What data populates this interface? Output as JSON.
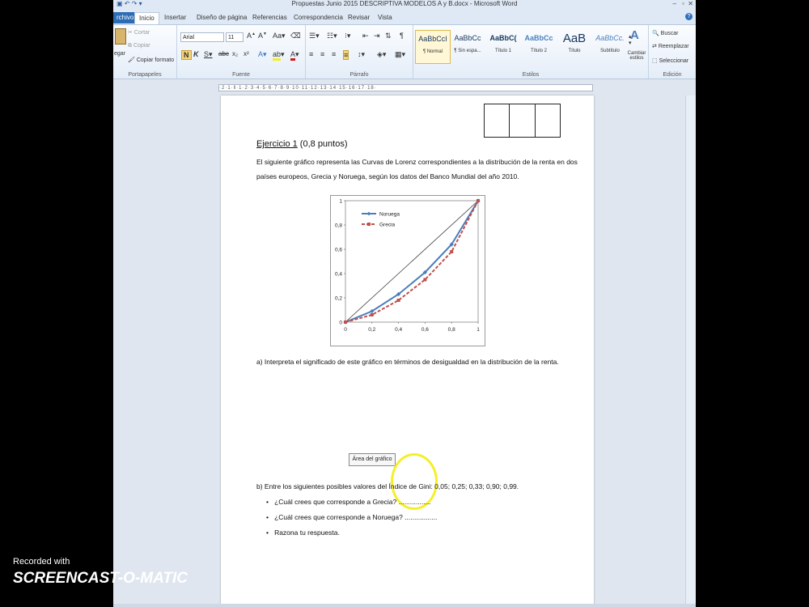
{
  "window": {
    "title": "Propuestas Junio 2015 DESCRIPTIVA MODELOS A y B.docx - Microsoft Word"
  },
  "tabs": [
    "rchivo",
    "Inicio",
    "Insertar",
    "Diseño de página",
    "Referencias",
    "Correspondencia",
    "Revisar",
    "Vista"
  ],
  "ribbon": {
    "clipboard": {
      "paste_label": "egar",
      "cut": "Cortar",
      "copy": "Copiar",
      "format_painter": "Copiar formato",
      "group": "Portapapeles"
    },
    "font": {
      "name": "Arial",
      "size": "11",
      "group": "Fuente"
    },
    "paragraph": {
      "group": "Párrafo"
    },
    "styles": {
      "items": [
        {
          "preview": "AaBbCcI",
          "label": "¶ Normal"
        },
        {
          "preview": "AaBbCc",
          "label": "¶ Sin espa..."
        },
        {
          "preview": "AaBbC(",
          "label": "Título 1"
        },
        {
          "preview": "AaBbCc",
          "label": "Título 2"
        },
        {
          "preview": "AaB",
          "label": "Título"
        },
        {
          "preview": "AaBbCc.",
          "label": "Subtítulo"
        }
      ],
      "change_label": "Cambiar estilos",
      "group": "Estilos"
    },
    "editing": {
      "find": "Buscar",
      "replace": "Reemplazar",
      "select": "Seleccionar",
      "group": "Edición"
    }
  },
  "doc": {
    "heading_underlined": "Ejercicio 1",
    "heading_rest": " (0,8 puntos)",
    "para_line1": "El siguiente gráfico representa las Curvas de Lorenz correspondientes a la distribución de la renta en dos",
    "para_line2": "países europeos, Grecia y Noruega, según los datos del Banco Mundial del año 2010.",
    "question_a": "a)  Interpreta el significado de este gráfico en términos de desigualdad en la distribución de la renta.",
    "chart_tooltip": "Área del gráfico",
    "question_b": "b)  Entre los siguientes posibles valores del Índice de Gini: 0,05; 0,25; 0,33; 0,90; 0,99.",
    "bullet1": "¿Cuál crees que corresponde a Grecia? .................",
    "bullet2": "¿Cuál crees que corresponde a Noruega? .................",
    "bullet3": "Razona tu respuesta."
  },
  "watermark": {
    "recorded": "Recorded with",
    "brand": "SCREENCAST-O-MATIC"
  },
  "chart_data": {
    "type": "line",
    "x": [
      0,
      0.2,
      0.4,
      0.6,
      0.8,
      1
    ],
    "xlim": [
      0,
      1
    ],
    "ylim": [
      0,
      1
    ],
    "x_ticks": [
      "0",
      "0,2",
      "0,4",
      "0,6",
      "0,8",
      "1"
    ],
    "y_ticks": [
      "0",
      "0,2",
      "0,4",
      "0,6",
      "0,8",
      "1"
    ],
    "legend_position": "top-left",
    "series": [
      {
        "name": "Noruega",
        "values": [
          0,
          0.09,
          0.23,
          0.41,
          0.64,
          1
        ],
        "color": "#4a7ebb"
      },
      {
        "name": "Grecia",
        "values": [
          0,
          0.06,
          0.18,
          0.35,
          0.58,
          1
        ],
        "color": "#c0504d"
      }
    ],
    "equality_line": {
      "values": [
        0,
        1
      ],
      "color": "#404040"
    }
  }
}
